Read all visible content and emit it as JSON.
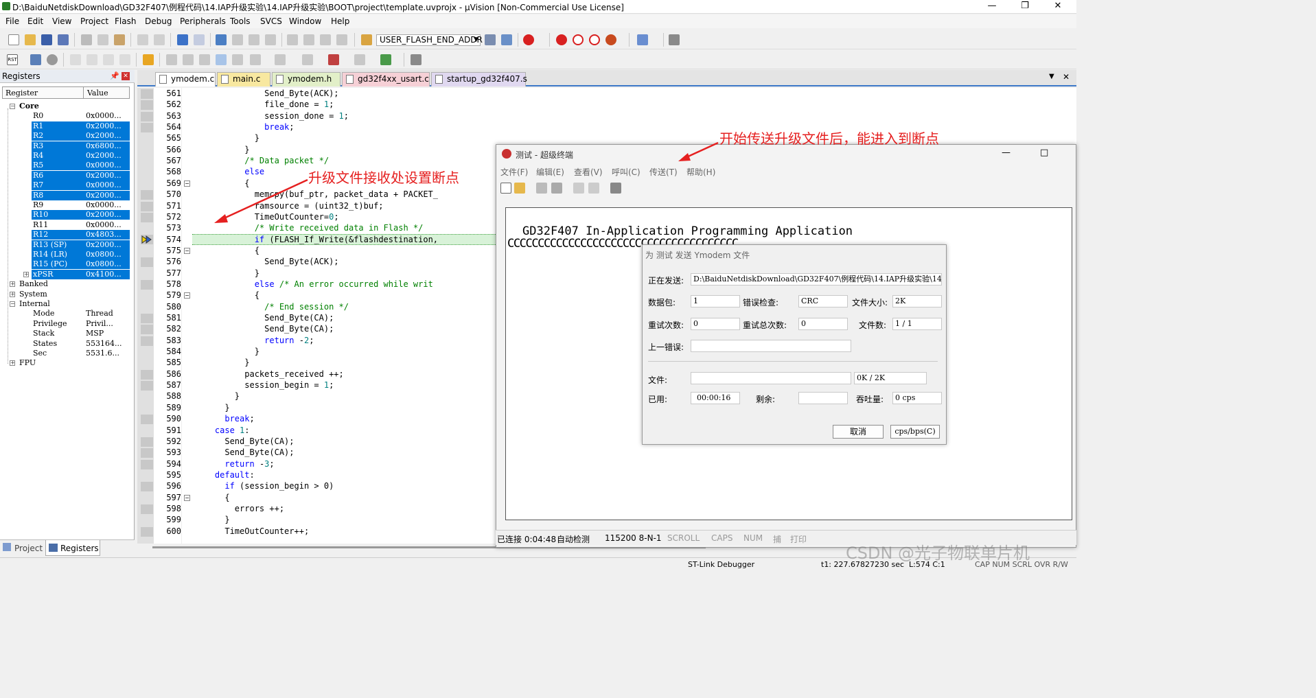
{
  "window": {
    "title": "D:\\BaiduNetdiskDownload\\GD32F407\\例程代码\\14.IAP升级实验\\14.IAP升级实验\\BOOT\\project\\template.uvprojx - µVision  [Non-Commercial Use License]"
  },
  "menu": [
    "File",
    "Edit",
    "View",
    "Project",
    "Flash",
    "Debug",
    "Peripherals",
    "Tools",
    "SVCS",
    "Window",
    "Help"
  ],
  "toolbar": {
    "target_label": "USER_FLASH_END_ADDR"
  },
  "registers": {
    "panel_title": "Registers",
    "col_register": "Register",
    "col_value": "Value",
    "core_label": "Core",
    "core": [
      {
        "name": "R0",
        "value": "0x0000...",
        "sel": false
      },
      {
        "name": "R1",
        "value": "0x2000...",
        "sel": true
      },
      {
        "name": "R2",
        "value": "0x2000...",
        "sel": true
      },
      {
        "name": "R3",
        "value": "0x6800...",
        "sel": true
      },
      {
        "name": "R4",
        "value": "0x2000...",
        "sel": true
      },
      {
        "name": "R5",
        "value": "0x0000...",
        "sel": true
      },
      {
        "name": "R6",
        "value": "0x2000...",
        "sel": true
      },
      {
        "name": "R7",
        "value": "0x0000...",
        "sel": true
      },
      {
        "name": "R8",
        "value": "0x2000...",
        "sel": true
      },
      {
        "name": "R9",
        "value": "0x0000...",
        "sel": false
      },
      {
        "name": "R10",
        "value": "0x2000...",
        "sel": true
      },
      {
        "name": "R11",
        "value": "0x0000...",
        "sel": false
      },
      {
        "name": "R12",
        "value": "0x4803...",
        "sel": true
      },
      {
        "name": "R13 (SP)",
        "value": "0x2000...",
        "sel": true
      },
      {
        "name": "R14 (LR)",
        "value": "0x0800...",
        "sel": true
      },
      {
        "name": "R15 (PC)",
        "value": "0x0800...",
        "sel": true
      },
      {
        "name": "xPSR",
        "value": "0x4100...",
        "sel": true
      }
    ],
    "groups": [
      "Banked",
      "System",
      "Internal"
    ],
    "internal": [
      {
        "name": "Mode",
        "value": "Thread"
      },
      {
        "name": "Privilege",
        "value": "Privil..."
      },
      {
        "name": "Stack",
        "value": "MSP"
      },
      {
        "name": "States",
        "value": "553164..."
      },
      {
        "name": "Sec",
        "value": "5531.6..."
      }
    ],
    "fpu_label": "FPU"
  },
  "bottom_tabs": [
    "Project",
    "Registers"
  ],
  "editor": {
    "tabs": [
      {
        "label": "ymodem.c",
        "active": true,
        "color": "#ffffff"
      },
      {
        "label": "main.c",
        "active": false,
        "color": "#f8e8a0"
      },
      {
        "label": "ymodem.h",
        "active": false,
        "color": "#e2efc8"
      },
      {
        "label": "gd32f4xx_usart.c",
        "active": false,
        "color": "#f6d0d6"
      },
      {
        "label": "startup_gd32f407.s",
        "active": false,
        "color": "#e0d8f0"
      }
    ],
    "lines": [
      {
        "n": "561",
        "t": "              Send_Byte(ACK);"
      },
      {
        "n": "562",
        "t": "              file_done = 1;"
      },
      {
        "n": "563",
        "t": "              session_done = 1;"
      },
      {
        "n": "564",
        "t": "              break;"
      },
      {
        "n": "565",
        "t": "            }"
      },
      {
        "n": "566",
        "t": "          }"
      },
      {
        "n": "567",
        "t": "          /* Data packet */"
      },
      {
        "n": "568",
        "t": "          else"
      },
      {
        "n": "569",
        "t": "          {"
      },
      {
        "n": "570",
        "t": "            memcpy(buf_ptr, packet_data + PACKET_"
      },
      {
        "n": "571",
        "t": "            ramsource = (uint32_t)buf;"
      },
      {
        "n": "572",
        "t": "            TimeOutCounter=0;"
      },
      {
        "n": "573",
        "t": "            /* Write received data in Flash */"
      },
      {
        "n": "574",
        "t": "            if (FLASH_If_Write(&flashdestination,"
      },
      {
        "n": "575",
        "t": "            {"
      },
      {
        "n": "576",
        "t": "              Send_Byte(ACK);"
      },
      {
        "n": "577",
        "t": "            }"
      },
      {
        "n": "578",
        "t": "            else /* An error occurred while writ"
      },
      {
        "n": "579",
        "t": "            {"
      },
      {
        "n": "580",
        "t": "              /* End session */"
      },
      {
        "n": "581",
        "t": "              Send_Byte(CA);"
      },
      {
        "n": "582",
        "t": "              Send_Byte(CA);"
      },
      {
        "n": "583",
        "t": "              return -2;"
      },
      {
        "n": "584",
        "t": "            }"
      },
      {
        "n": "585",
        "t": "          }"
      },
      {
        "n": "586",
        "t": "          packets_received ++;"
      },
      {
        "n": "587",
        "t": "          session_begin = 1;"
      },
      {
        "n": "588",
        "t": "        }"
      },
      {
        "n": "589",
        "t": "      }"
      },
      {
        "n": "590",
        "t": "      break;"
      },
      {
        "n": "591",
        "t": "    case 1:"
      },
      {
        "n": "592",
        "t": "      Send_Byte(CA);"
      },
      {
        "n": "593",
        "t": "      Send_Byte(CA);"
      },
      {
        "n": "594",
        "t": "      return -3;"
      },
      {
        "n": "595",
        "t": "    default:"
      },
      {
        "n": "596",
        "t": "      if (session_begin > 0)"
      },
      {
        "n": "597",
        "t": "      {"
      },
      {
        "n": "598",
        "t": "        errors ++;"
      },
      {
        "n": "599",
        "t": "      }"
      },
      {
        "n": "600",
        "t": "      TimeOutCounter++;"
      }
    ]
  },
  "terminal": {
    "title": "测试 - 超级终端",
    "menu": [
      "文件(F)",
      "编辑(E)",
      "查看(V)",
      "呼叫(C)",
      "传送(T)",
      "帮助(H)"
    ],
    "screen_line1": "GD32F407 In-Application Programming Application",
    "screen_line2": "CCCCCCCCCCCCCCCCCCCCCCCCCCCCCCCCCCCCCC",
    "status": [
      "已连接 0:04:48",
      "自动检测",
      "115200 8-N-1",
      "SCROLL",
      "CAPS",
      "NUM",
      "捕",
      "打印"
    ]
  },
  "ymodem": {
    "title": "为 测试 发送 Ymodem 文件",
    "sending_label": "正在发送:",
    "sending_value": "D:\\BaiduNetdiskDownload\\GD32F407\\例程代码\\14.IAP升级实验\\14",
    "packet_label": "数据包:",
    "packet_value": "1",
    "errcheck_label": "错误检查:",
    "errcheck_value": "CRC",
    "filesize_label": "文件大小:",
    "filesize_value": "2K",
    "retries_label": "重试次数:",
    "retries_value": "0",
    "total_retries_label": "重试总次数:",
    "total_retries_value": "0",
    "files_label": "文件数:",
    "files_value": "1 / 1",
    "last_error_label": "上一错误:",
    "last_error_value": "",
    "file_label": "文件:",
    "file_progress": "0K / 2K",
    "elapsed_label": "已用:",
    "elapsed_value": "00:00:16",
    "remaining_label": "剩余:",
    "remaining_value": "",
    "throughput_label": "吞吐量:",
    "throughput_value": "0 cps",
    "cancel_label": "取消",
    "cps_label": "cps/bps(C)"
  },
  "annotations": {
    "breakpoint_note": "升级文件接收处设置断点",
    "transfer_note": "开始传送升级文件后，能进入到断点"
  },
  "statusbar": {
    "debugger": "ST-Link Debugger",
    "time": "t1: 227.67827230 sec",
    "pos": "L:574 C:1",
    "flags": "CAP  NUM  SCRL  OVR  R/W"
  },
  "watermark": "CSDN @光子物联单片机",
  "colors": {
    "accent": "#0078d7",
    "annotation": "#e52020"
  }
}
